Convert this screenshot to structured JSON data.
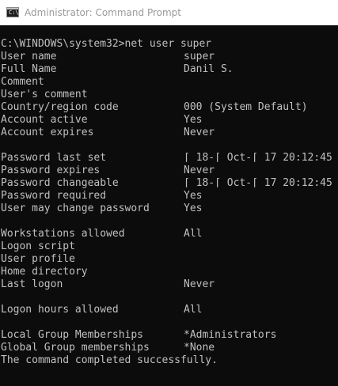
{
  "window": {
    "title": "Administrator: Command Prompt",
    "icon": "command-prompt-icon",
    "icon_glyph": "C:\\"
  },
  "console": {
    "command": "C:\\WINDOWS\\system32>net user super",
    "rows": [
      {
        "label": "User name",
        "value": "super"
      },
      {
        "label": "Full Name",
        "value": "Danil S."
      },
      {
        "label": "Comment",
        "value": ""
      },
      {
        "label": "User's comment",
        "value": ""
      },
      {
        "label": "Country/region code",
        "value": "000 (System Default)"
      },
      {
        "label": "Account active",
        "value": "Yes"
      },
      {
        "label": "Account expires",
        "value": "Never"
      },
      {
        "label": "",
        "value": ""
      },
      {
        "label": "Password last set",
        "value": "⌈ 18-⌈ Oct-⌈ 17 20:12:45"
      },
      {
        "label": "Password expires",
        "value": "Never"
      },
      {
        "label": "Password changeable",
        "value": "⌈ 18-⌈ Oct-⌈ 17 20:12:45"
      },
      {
        "label": "Password required",
        "value": "Yes"
      },
      {
        "label": "User may change password",
        "value": "Yes"
      },
      {
        "label": "",
        "value": ""
      },
      {
        "label": "Workstations allowed",
        "value": "All"
      },
      {
        "label": "Logon script",
        "value": ""
      },
      {
        "label": "User profile",
        "value": ""
      },
      {
        "label": "Home directory",
        "value": ""
      },
      {
        "label": "Last logon",
        "value": "Never"
      },
      {
        "label": "",
        "value": ""
      },
      {
        "label": "Logon hours allowed",
        "value": "All"
      },
      {
        "label": "",
        "value": ""
      },
      {
        "label": "Local Group Memberships",
        "value": "*Administrators"
      },
      {
        "label": "Global Group memberships",
        "value": "*None"
      }
    ],
    "completion": "The command completed successfully."
  }
}
